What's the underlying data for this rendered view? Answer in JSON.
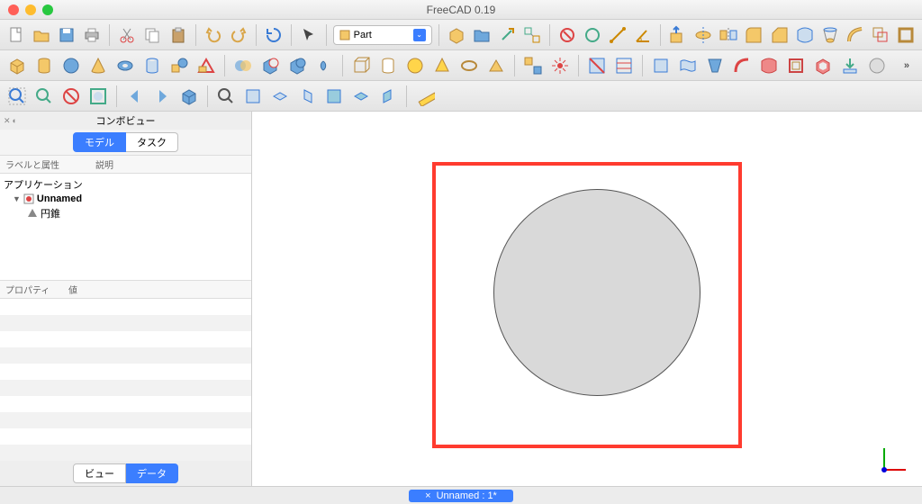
{
  "title": "FreeCAD 0.19",
  "workbench": {
    "label": "Part"
  },
  "combo": {
    "title": "コンボビュー",
    "tabs": {
      "model": "モデル",
      "task": "タスク"
    },
    "headers": {
      "label": "ラベルと属性",
      "desc": "説明"
    },
    "tree": {
      "app": "アプリケーション",
      "doc": "Unnamed",
      "obj": "円錐"
    },
    "prop_headers": {
      "prop": "プロパティ",
      "val": "値"
    },
    "bottom_tabs": {
      "view": "ビュー",
      "data": "データ"
    }
  },
  "status": {
    "doc": "Unnamed : 1*",
    "close": "×"
  },
  "more": "»"
}
